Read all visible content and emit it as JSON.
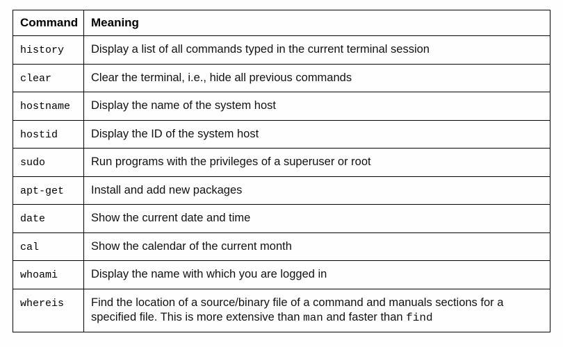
{
  "headers": {
    "command": "Command",
    "meaning": "Meaning"
  },
  "rows": [
    {
      "command": "history",
      "meaning": "Display a list of all commands typed in the current terminal session"
    },
    {
      "command": "clear",
      "meaning": "Clear the terminal, i.e., hide all previous commands"
    },
    {
      "command": "hostname",
      "meaning": "Display the name of the system host"
    },
    {
      "command": "hostid",
      "meaning": "Display the ID of the system host"
    },
    {
      "command": "sudo",
      "meaning": "Run programs with the privileges of a superuser or root"
    },
    {
      "command": "apt-get",
      "meaning": "Install and add new packages"
    },
    {
      "command": "date",
      "meaning": "Show the current date and time"
    },
    {
      "command": "cal",
      "meaning": "Show the calendar of the current month"
    },
    {
      "command": "whoami",
      "meaning": "Display the name with which you are logged in"
    },
    {
      "command": "whereis",
      "meaning_parts": [
        {
          "t": "text",
          "v": "Find the location of a source/binary file of a command and manuals sections for a specified file. This is more extensive than "
        },
        {
          "t": "code",
          "v": "man"
        },
        {
          "t": "text",
          "v": " and faster than "
        },
        {
          "t": "code",
          "v": "find"
        }
      ]
    }
  ]
}
